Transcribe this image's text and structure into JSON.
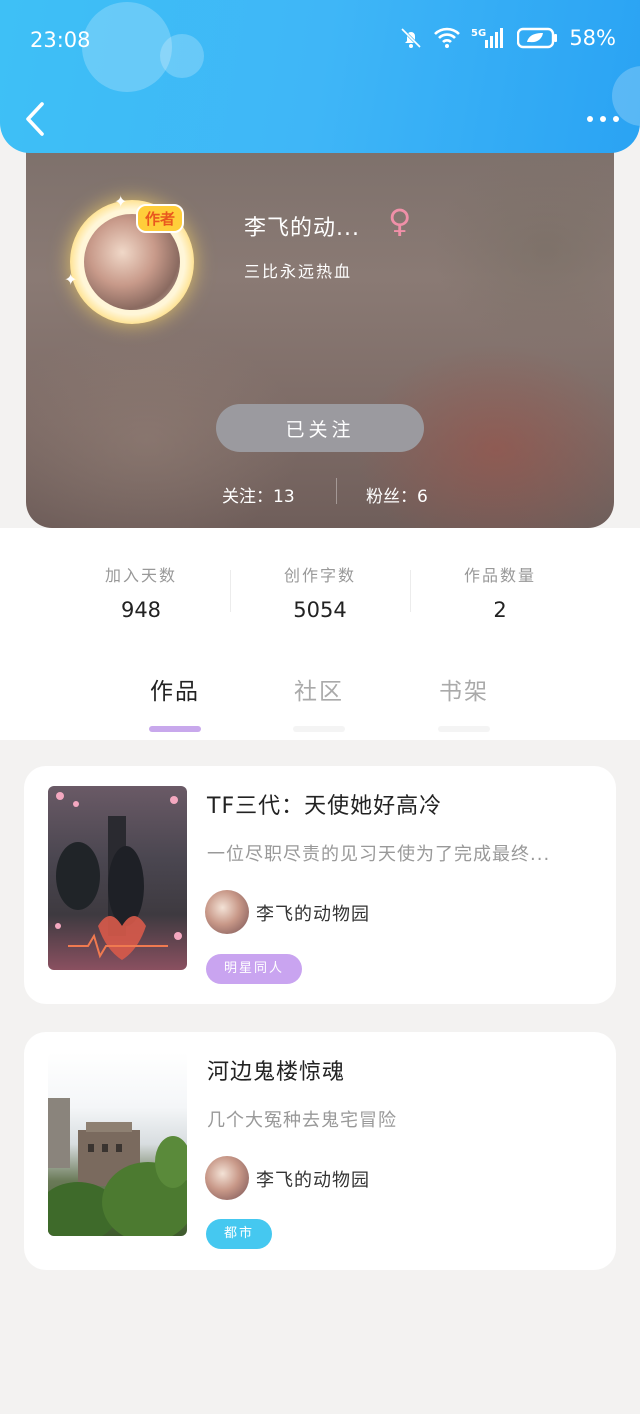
{
  "status_bar": {
    "time": "23:08",
    "battery": "58%"
  },
  "icons": {
    "back": "chevron-left-icon",
    "more": "more-horizontal-icon",
    "gender": "female-icon",
    "mute": "bell-off-icon",
    "wifi": "wifi-icon",
    "signal": "cellular-signal-icon",
    "battery": "battery-icon"
  },
  "profile": {
    "author_badge": "作者",
    "nickname": "李飞的动...",
    "gender_symbol": "♀",
    "signature": "三比永远热血",
    "follow_button": "已关注",
    "following": "关注：13",
    "fans": "粉丝：6"
  },
  "stats": [
    {
      "label": "加入天数",
      "value": "948"
    },
    {
      "label": "创作字数",
      "value": "5054"
    },
    {
      "label": "作品数量",
      "value": "2"
    }
  ],
  "tabs": [
    {
      "label": "作品",
      "active": true
    },
    {
      "label": "社区",
      "active": false
    },
    {
      "label": "书架",
      "active": false
    }
  ],
  "books": [
    {
      "title": "TF三代：天使她好高冷",
      "description": "一位尽职尽责的见习天使为了完成最终...",
      "author": "李飞的动物园",
      "tag": "明星同人",
      "tag_color": "#c9a4f0"
    },
    {
      "title": "河边鬼楼惊魂",
      "description": "几个大冤种去鬼宅冒险",
      "author": "李飞的动物园",
      "tag": "都市",
      "tag_color": "#45c8f0"
    }
  ],
  "colors": {
    "header": "#3fb6f7",
    "tab_active_underline": "#c8a8ec",
    "follow_button": "#9b9a9f",
    "gender": "#f090a8"
  }
}
